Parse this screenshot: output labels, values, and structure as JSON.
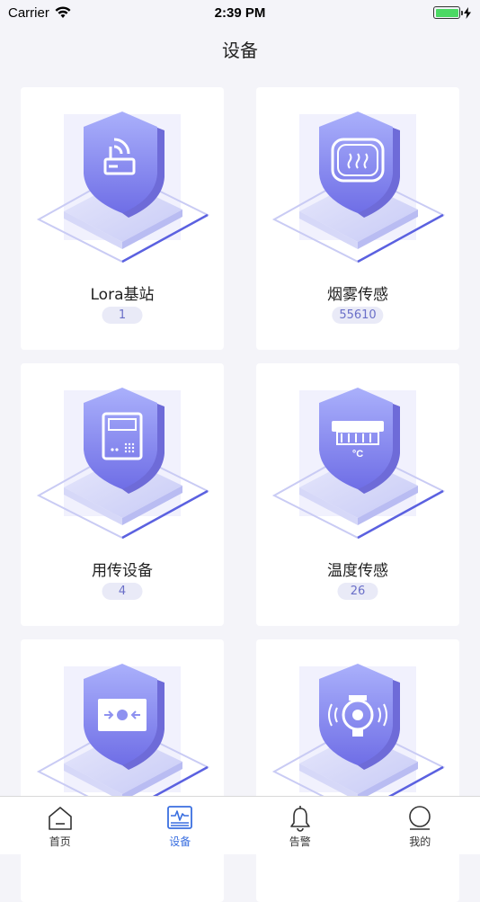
{
  "status_bar": {
    "carrier": "Carrier",
    "time": "2:39 PM"
  },
  "nav": {
    "title": "设备"
  },
  "devices": [
    {
      "name": "Lora基站",
      "count": "1",
      "icon": "router-icon"
    },
    {
      "name": "烟雾传感",
      "count": "55610",
      "icon": "smoke-detector-icon"
    },
    {
      "name": "用传设备",
      "count": "4",
      "icon": "transmitter-icon"
    },
    {
      "name": "温度传感",
      "count": "26",
      "icon": "thermometer-icon"
    },
    {
      "name": "",
      "count": "",
      "icon": "door-sensor-icon"
    },
    {
      "name": "",
      "count": "",
      "icon": "water-meter-icon"
    }
  ],
  "tabs": [
    {
      "label": "首页",
      "icon": "home-icon"
    },
    {
      "label": "设备",
      "icon": "monitor-icon",
      "active": true
    },
    {
      "label": "告警",
      "icon": "bell-icon"
    },
    {
      "label": "我的",
      "icon": "user-icon"
    }
  ],
  "colors": {
    "accent": "#3a6fe0",
    "badge_bg": "#e9eaf7",
    "badge_text": "#6a6fc8",
    "shield": "#8e91f0"
  }
}
